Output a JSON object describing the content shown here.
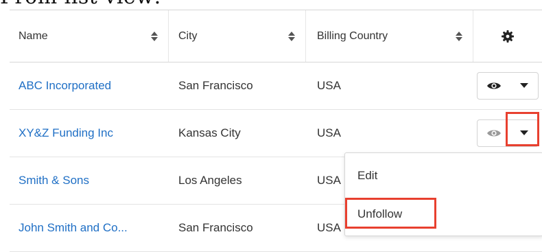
{
  "page": {
    "heading": "From list view:"
  },
  "table": {
    "columns": [
      {
        "label": "Name"
      },
      {
        "label": "City"
      },
      {
        "label": "Billing Country"
      }
    ],
    "settings_icon": "gear-icon",
    "rows": [
      {
        "name": "ABC Incorporated",
        "city": "San Francisco",
        "country": "USA"
      },
      {
        "name": "XY&Z Funding Inc",
        "city": "Kansas City",
        "country": "USA"
      },
      {
        "name": "Smith & Sons",
        "city": "Los Angeles",
        "country": "USA"
      },
      {
        "name": "John Smith and Co...",
        "city": "San Francisco",
        "country": "USA"
      }
    ]
  },
  "row_actions": {
    "preview_icon": "eye-icon",
    "menu_icon": "caret-down-icon"
  },
  "dropdown_menu": {
    "items": [
      {
        "label": "Edit"
      },
      {
        "label": "Unfollow"
      }
    ]
  },
  "colors": {
    "link": "#1f6fc5",
    "highlight": "#e8402f",
    "border": "#d6d6d6"
  }
}
